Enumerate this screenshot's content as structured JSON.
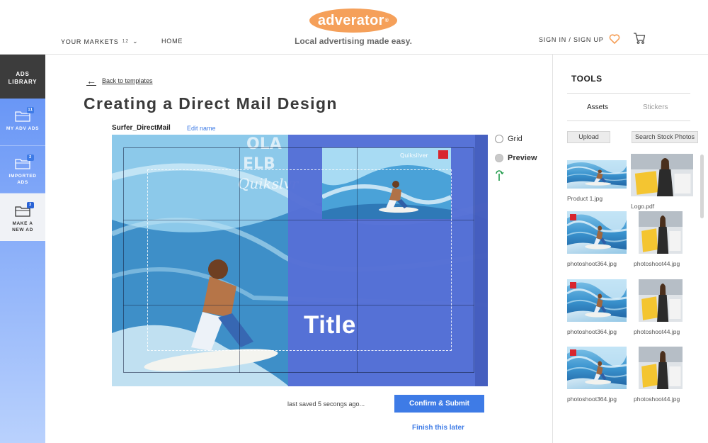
{
  "header": {
    "markets_label": "YOUR MARKETS",
    "markets_count": "12",
    "home_label": "HOME",
    "logo_text": "adverator",
    "logo_mark": "®",
    "tagline": "Local advertising made easy.",
    "signin_label": "SIGN IN / SIGN UP",
    "icons": [
      "chevron-down-icon",
      "heart-icon",
      "cart-icon"
    ],
    "accent_color": "#f5a05a"
  },
  "sidebar": {
    "title_line1": "ADS",
    "title_line2": "LIBRARY",
    "items": [
      {
        "label_line1": "MY ADV ADS",
        "label_line2": "",
        "badge": "11",
        "icon": "folder-icon"
      },
      {
        "label_line1": "IMPORTED",
        "label_line2": "ADS",
        "badge": "2",
        "icon": "folder-icon"
      },
      {
        "label_line1": "MAKE A",
        "label_line2": "NEW AD",
        "badge": "3",
        "icon": "folder-icon",
        "active": true
      }
    ]
  },
  "main": {
    "back_label": "Back to templates",
    "page_title": "Creating a Direct Mail Design",
    "design_name": "Surfer_DirectMail",
    "edit_name_label": "Edit name",
    "canvas_title": "Title",
    "options": {
      "grid_label": "Grid",
      "preview_label": "Preview"
    },
    "last_saved": "last saved 5 secongs ago...",
    "confirm_label": "Confirm & Submit",
    "finish_later_label": "Finish this later",
    "primary_color": "#3e7be6"
  },
  "tools": {
    "title": "TOOLS",
    "tabs": [
      "Assets",
      "Stickers"
    ],
    "upload_label": "Upload",
    "stock_label": "Search Stock Photos",
    "assets": [
      {
        "name": "Product 1.jpg"
      },
      {
        "name": "Logo.pdf"
      },
      {
        "name": "photoshoot364.jpg"
      },
      {
        "name": "photoshoot44.jpg"
      },
      {
        "name": "photoshoot364.jpg"
      },
      {
        "name": "photoshoot44.jpg"
      },
      {
        "name": "photoshoot364.jpg"
      },
      {
        "name": "photoshoot44.jpg"
      }
    ]
  }
}
